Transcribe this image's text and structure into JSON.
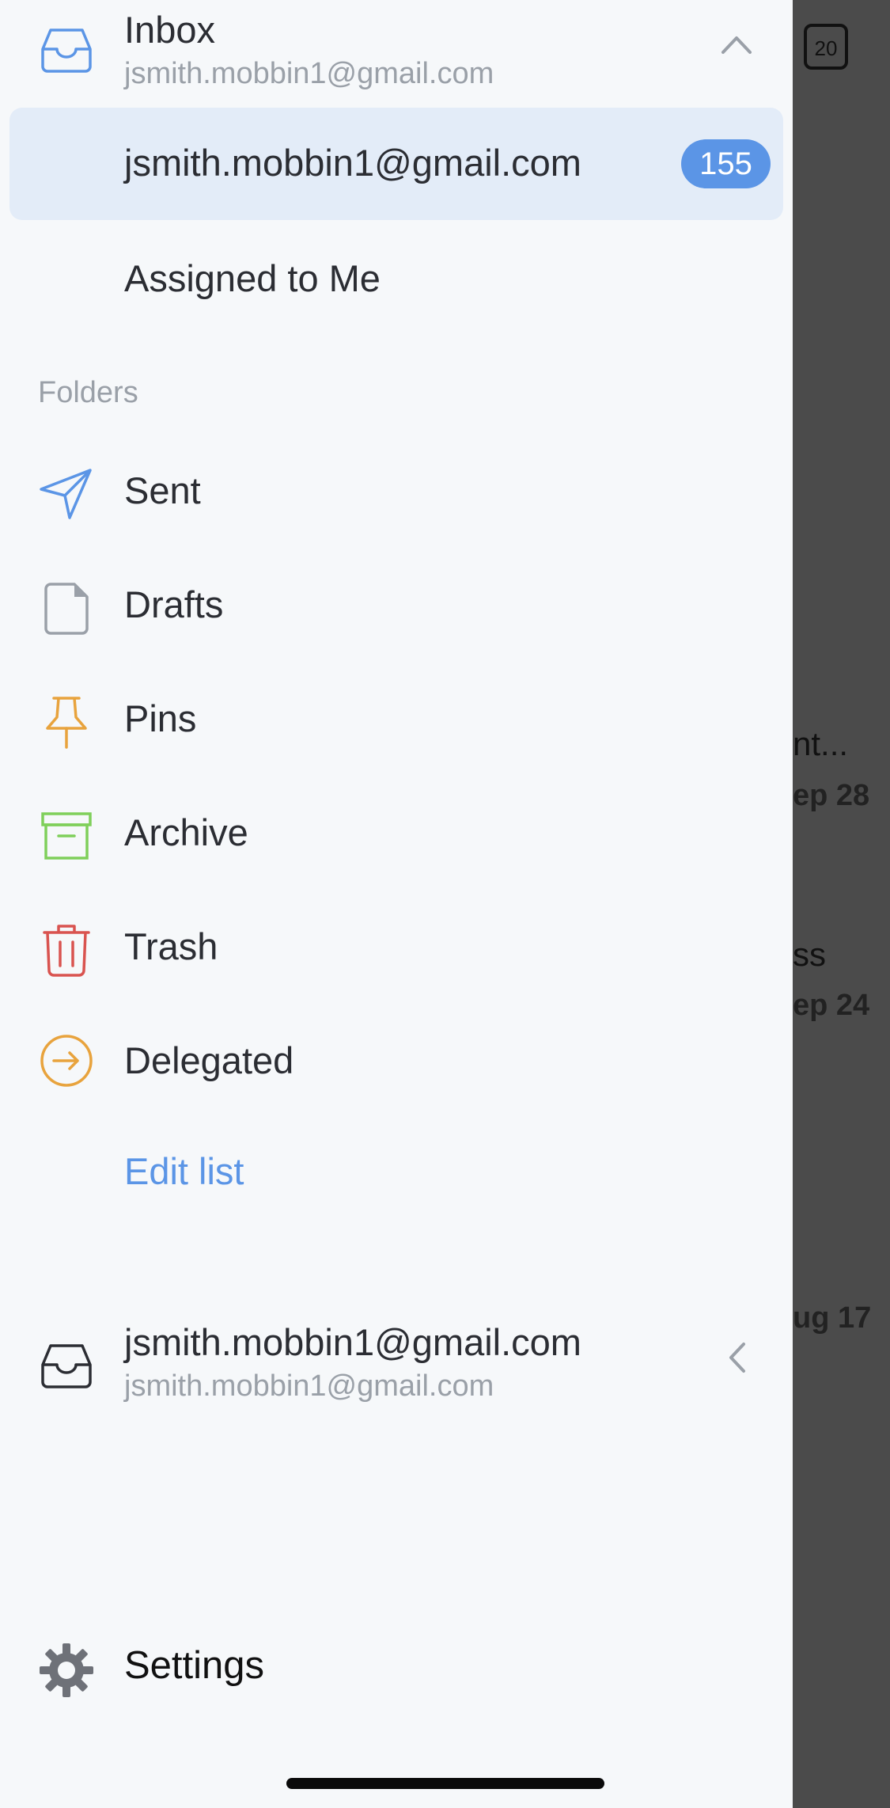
{
  "background_app": {
    "calendar_day": "20",
    "fragments": [
      {
        "text": "nt...",
        "sub": "ep 28"
      },
      {
        "text": "ss",
        "sub": "ep 24"
      },
      {
        "text": "",
        "sub": "ug 17"
      }
    ]
  },
  "drawer": {
    "inbox": {
      "title": "Inbox",
      "account": "jsmith.mobbin1@gmail.com"
    },
    "inbox_items": [
      {
        "label": "jsmith.mobbin1@gmail.com",
        "badge": "155",
        "selected": true
      },
      {
        "label": "Assigned to Me"
      }
    ],
    "folders_header": "Folders",
    "folders": [
      {
        "label": "Sent",
        "icon": "send-icon",
        "color": "#5b95e6"
      },
      {
        "label": "Drafts",
        "icon": "draft-icon",
        "color": "#9aa0a8"
      },
      {
        "label": "Pins",
        "icon": "pin-icon",
        "color": "#e8a33d"
      },
      {
        "label": "Archive",
        "icon": "archive-icon",
        "color": "#7fcf5a"
      },
      {
        "label": "Trash",
        "icon": "trash-icon",
        "color": "#d9534f"
      },
      {
        "label": "Delegated",
        "icon": "delegated-icon",
        "color": "#e8a33d"
      }
    ],
    "edit_list_label": "Edit list",
    "account_section": {
      "title": "jsmith.mobbin1@gmail.com",
      "subtitle": "jsmith.mobbin1@gmail.com"
    },
    "settings_label": "Settings"
  },
  "colors": {
    "accent": "#5b95e6",
    "drawer_bg": "#f6f8fa",
    "selected_bg": "#e3ecf8",
    "overlay": "#4b4b4b"
  }
}
